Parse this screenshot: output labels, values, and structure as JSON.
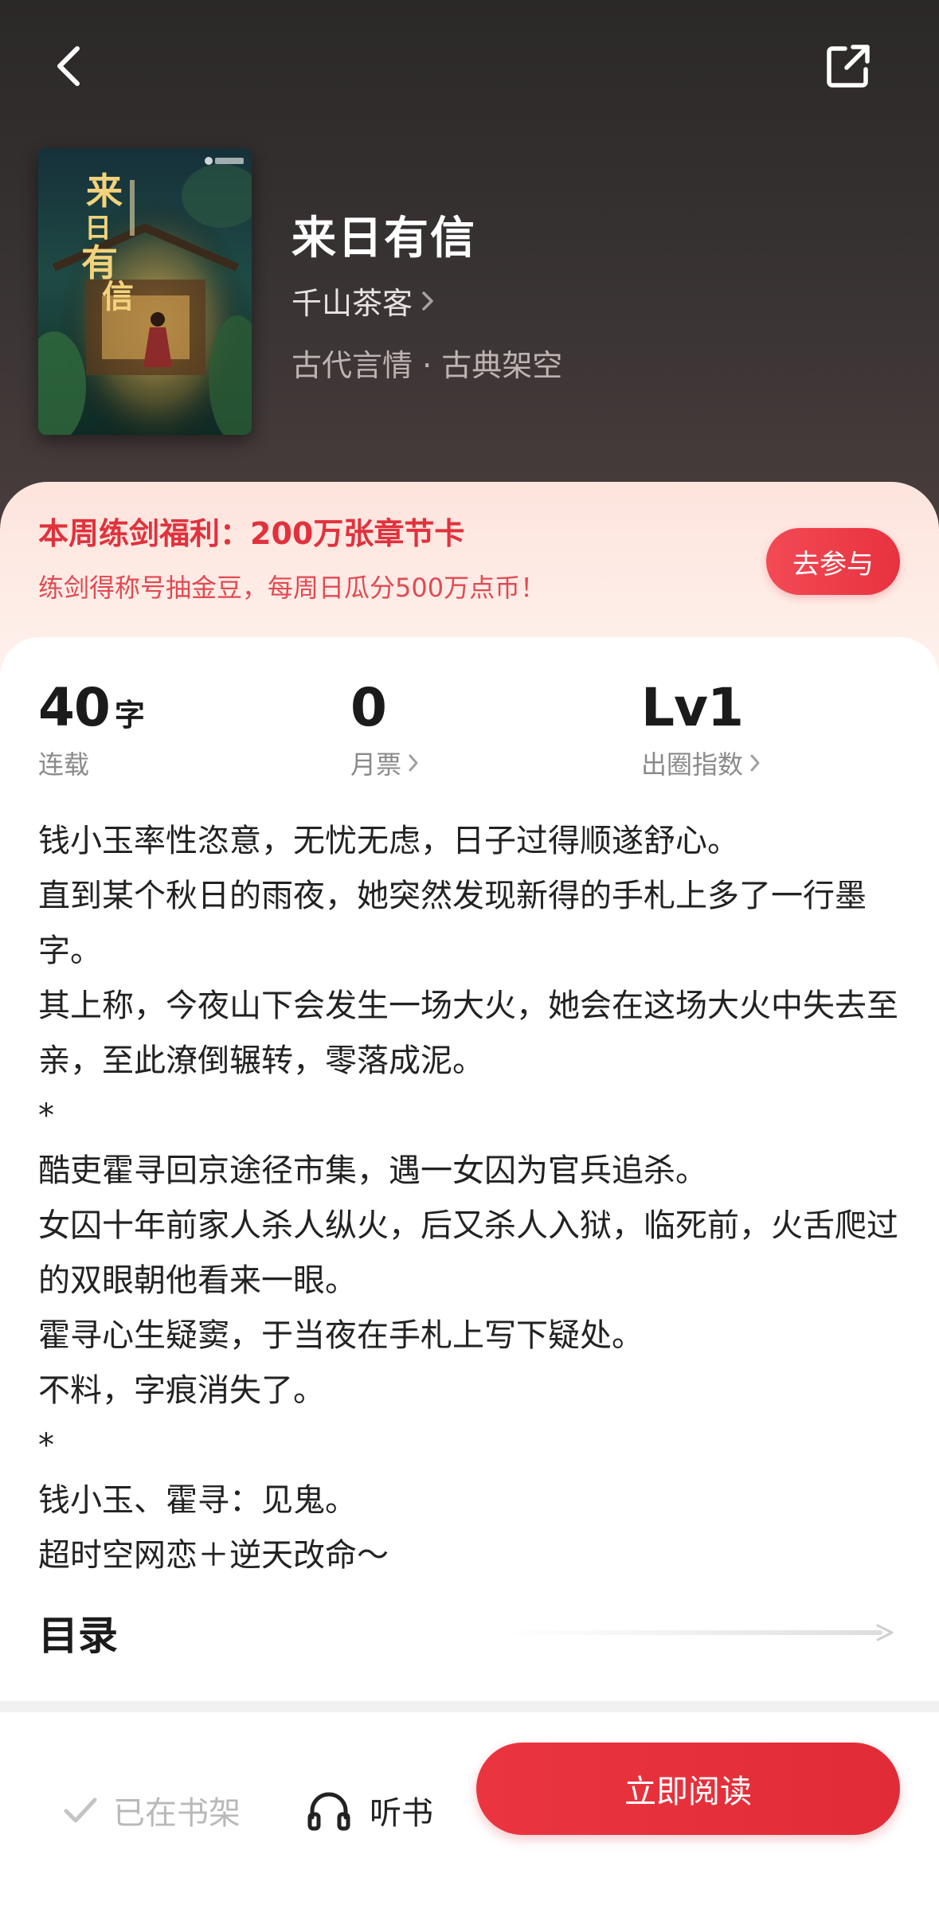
{
  "icons": {
    "back": "chevron-left-icon",
    "share": "share-icon",
    "author_arrow": "chevron-right-icon",
    "stat_arrow": "chevron-right-icon",
    "shelf_check": "check-icon",
    "headphones": "headphones-icon",
    "toc_arrow": "arrow-right-icon"
  },
  "colors": {
    "accent": "#e12c38",
    "promo_text": "#e0323d",
    "header_bg": "#2b2828"
  },
  "book": {
    "title": "来日有信",
    "author": "千山茶客",
    "genre": "古代言情 · 古典架空"
  },
  "promo": {
    "title": "本周练剑福利：200万张章节卡",
    "subtitle": "练剑得称号抽金豆，每周日瓜分500万点币！",
    "button": "去参与"
  },
  "stats": [
    {
      "value": "40",
      "unit": "字",
      "label": "连载"
    },
    {
      "value": "0",
      "unit": "",
      "label": "月票"
    },
    {
      "value": "Lv1",
      "unit": "",
      "label": "出圈指数"
    }
  ],
  "synopsis": [
    "钱小玉率性恣意，无忧无虑，日子过得顺遂舒心。",
    "直到某个秋日的雨夜，她突然发现新得的手札上多了一行墨字。",
    "其上称，今夜山下会发生一场大火，她会在这场大火中失去至亲，至此潦倒辗转，零落成泥。",
    "*",
    "酷吏霍寻回京途径市集，遇一女囚为官兵追杀。",
    "女囚十年前家人杀人纵火，后又杀人入狱，临死前，火舌爬过的双眼朝他看来一眼。",
    "霍寻心生疑窦，于当夜在手札上写下疑处。",
    "不料，字痕消失了。",
    "*",
    "钱小玉、霍寻：见鬼。",
    "超时空网恋＋逆天改命～"
  ],
  "toc": {
    "title": "目录"
  },
  "bottom": {
    "shelf": "已在书架",
    "listen": "听书",
    "read": "立即阅读"
  }
}
